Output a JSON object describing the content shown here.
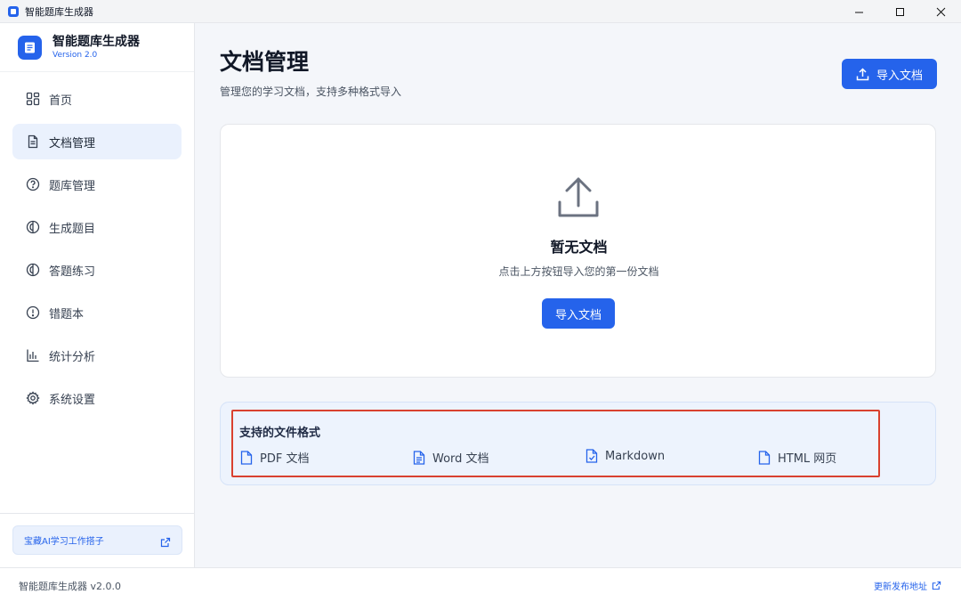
{
  "window": {
    "title": "智能题库生成器"
  },
  "brand": {
    "name": "智能题库生成器",
    "version": "Version 2.0"
  },
  "sidebar": {
    "items": [
      {
        "label": "首页",
        "icon": "grid-icon",
        "active": false
      },
      {
        "label": "文档管理",
        "icon": "document-icon",
        "active": true
      },
      {
        "label": "题库管理",
        "icon": "help-circle-icon",
        "active": false
      },
      {
        "label": "生成题目",
        "icon": "brain-icon",
        "active": false
      },
      {
        "label": "答题练习",
        "icon": "brain-icon",
        "active": false
      },
      {
        "label": "错题本",
        "icon": "alert-circle-icon",
        "active": false
      },
      {
        "label": "统计分析",
        "icon": "bar-chart-icon",
        "active": false
      },
      {
        "label": "系统设置",
        "icon": "gear-icon",
        "active": false
      }
    ],
    "promo": {
      "label": "宝藏AI学习工作搭子",
      "icon": "external-link-icon"
    }
  },
  "main": {
    "title": "文档管理",
    "subtitle": "管理您的学习文档，支持多种格式导入",
    "import_button_label": "导入文档",
    "empty": {
      "title": "暂无文档",
      "description": "点击上方按钮导入您的第一份文档",
      "button_label": "导入文档"
    },
    "formats": {
      "title": "支持的文件格式",
      "items": [
        {
          "label": "PDF 文档",
          "icon": "file-icon"
        },
        {
          "label": "Word 文档",
          "icon": "file-text-icon"
        },
        {
          "label": "Markdown",
          "icon": "file-check-icon"
        },
        {
          "label": "HTML 网页",
          "icon": "file-icon"
        }
      ]
    }
  },
  "statusbar": {
    "left": "智能题库生成器 v2.0.0",
    "right": "更新发布地址"
  },
  "colors": {
    "accent": "#2563eb",
    "highlight_border": "#d9412f",
    "active_nav_bg": "#eaf1fd"
  }
}
